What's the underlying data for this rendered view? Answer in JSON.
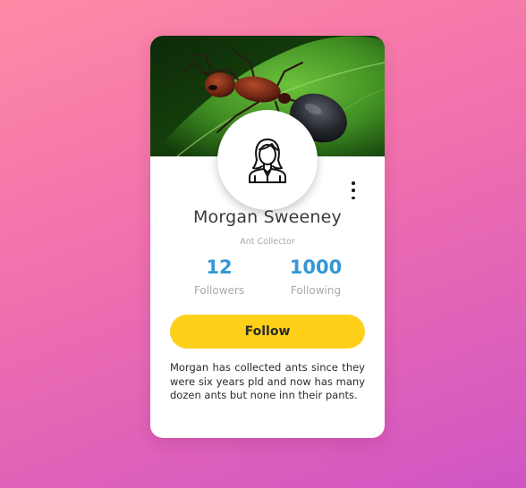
{
  "profile": {
    "name": "Morgan Sweeney",
    "role": "Ant Collector",
    "bio": "Morgan has collected ants since they were six years pld and now has many dozen ants but none inn their pants."
  },
  "stats": {
    "followers_count": "12",
    "followers_label": "Followers",
    "following_count": "1000",
    "following_label": "Following"
  },
  "actions": {
    "follow_label": "Follow"
  },
  "icons": {
    "cover": "ant-on-leaf-photo",
    "avatar": "person-avatar-icon",
    "menu": "vertical-ellipsis-icon"
  },
  "colors": {
    "accent_blue": "#3497d8",
    "follow_button": "#ffd01a",
    "card_background": "#ffffff",
    "background_gradient_start": "#fe8aa5",
    "background_gradient_end": "#cf55c4"
  }
}
